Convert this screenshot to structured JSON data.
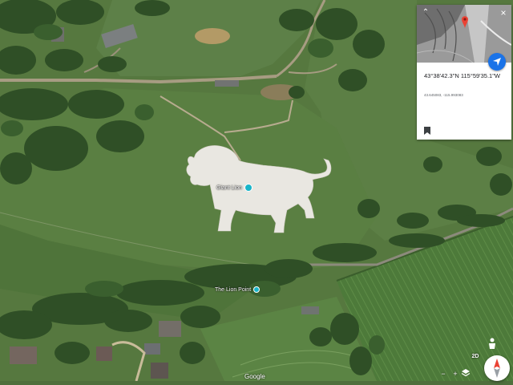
{
  "map": {
    "type": "satellite",
    "places": [
      {
        "label": "Giant Lion",
        "icon": "pin-icon"
      },
      {
        "label": "The Lion Point",
        "icon": "pin-icon"
      }
    ],
    "branding": "Google"
  },
  "info_card": {
    "coordinates": "43°38'42.3\"N 115°59'35.1\"W",
    "decimal_coordinates": "43.645083, -115.993083",
    "back_icon": "chevron-up-icon",
    "close_icon": "close-icon",
    "close_label": "×",
    "fly_icon": "navigation-arrow-icon",
    "bookmark_icon": "bookmark-icon",
    "accent_color": "#1a73e8",
    "pin_color": "#ea4335"
  },
  "controls": {
    "zoom_out": "−",
    "zoom_in": "+",
    "view_mode": "2D",
    "layers_icon": "layers-icon",
    "pegman_icon": "pegman-icon",
    "compass_icon": "compass-icon"
  }
}
